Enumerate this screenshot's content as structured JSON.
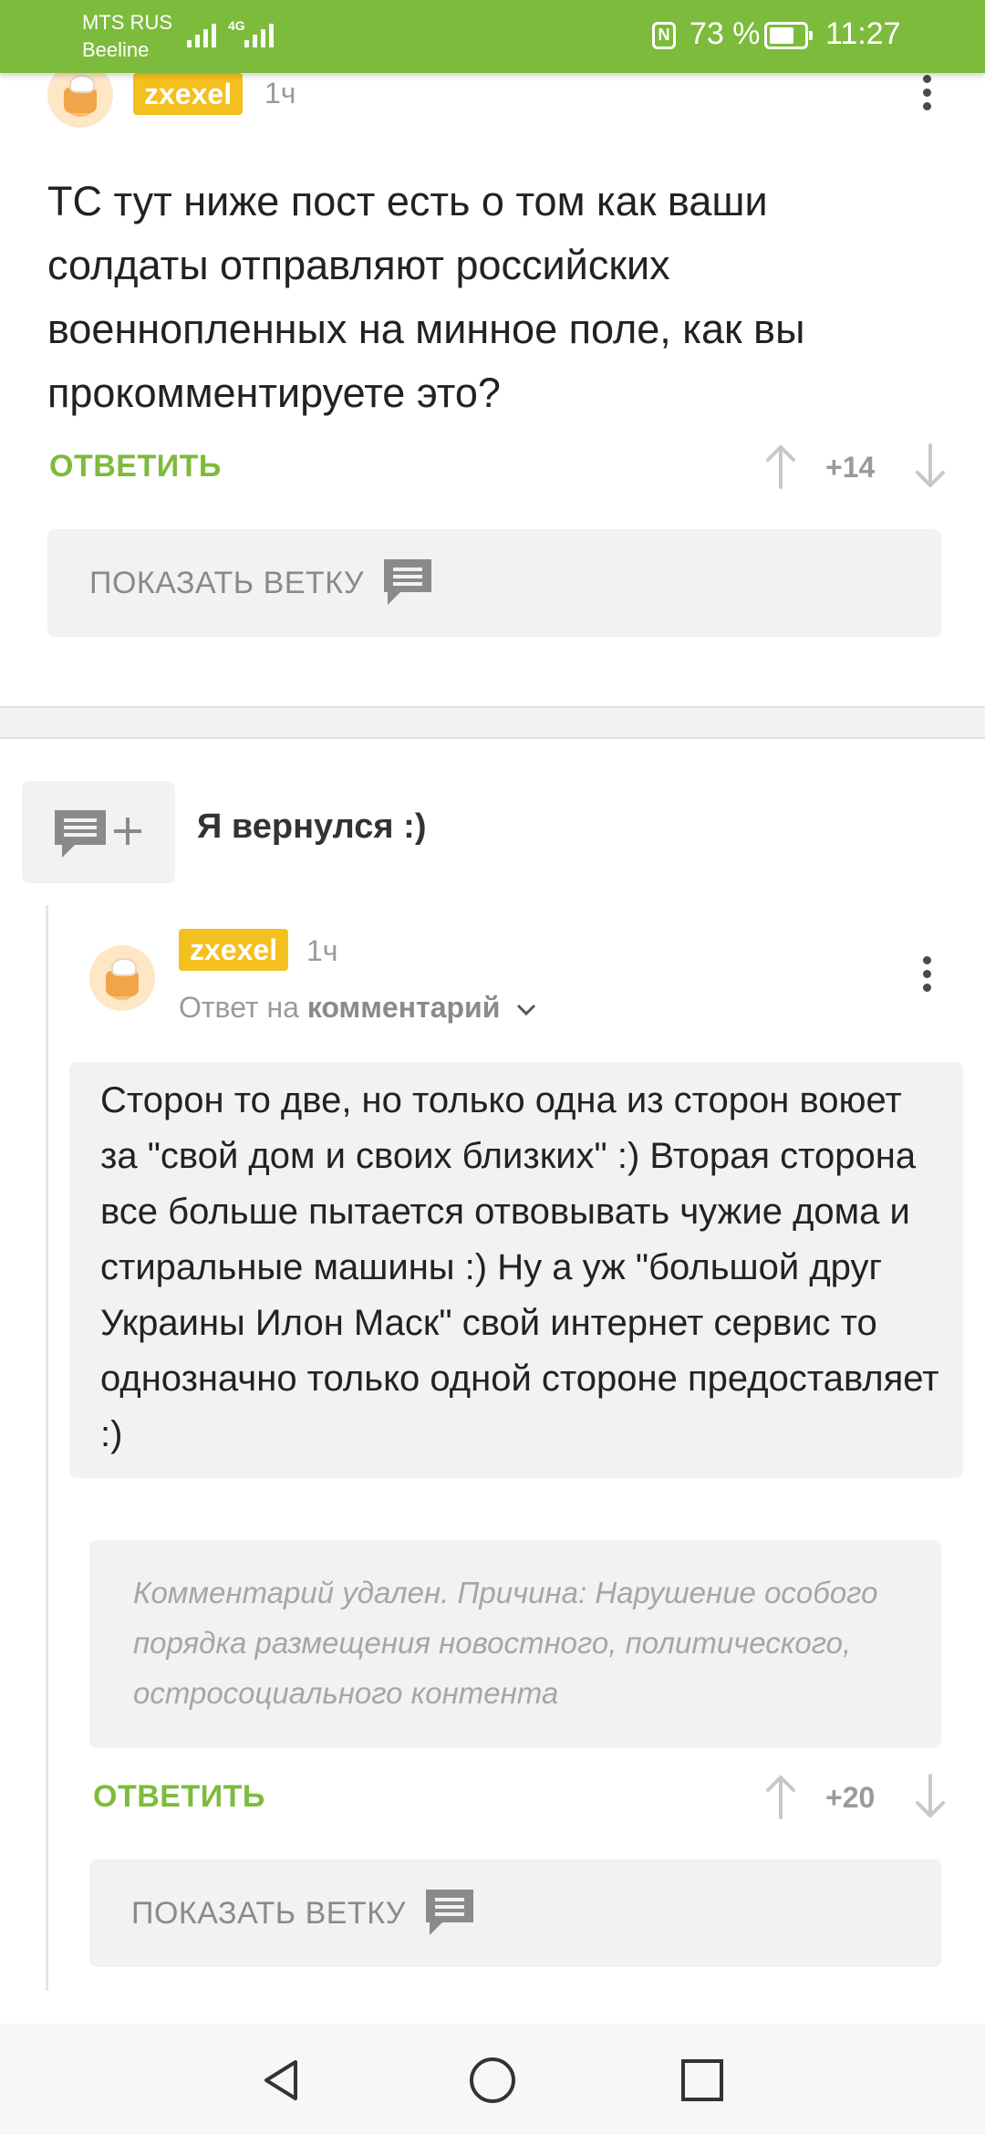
{
  "status_bar": {
    "carrier_1": "MTS RUS",
    "carrier_2": "Beeline",
    "network": "4G",
    "nfc_label": "N",
    "battery_text": "73 %",
    "battery_level": 0.73,
    "time": "11:27"
  },
  "comment1": {
    "username": "zxexel",
    "time": "1ч",
    "text": "ТС тут ниже пост есть о том как ваши солдаты отправляют российских военнопленных на минное поле, как вы прокомментируете это?",
    "reply_label": "ОТВЕТИТЬ",
    "votes": "+14",
    "show_branch_label": "ПОКАЗАТЬ ВЕТКУ"
  },
  "thread": {
    "title": "Я вернулся :)"
  },
  "comment2": {
    "username": "zxexel",
    "time": "1ч",
    "reply_prefix": "Ответ на",
    "reply_target": "комментарий",
    "text": "Сторон то две, но только одна из сторон воюет за \"свой дом и своих близких\" :) Вторая сторона все больше пытается отвовывать чужие дома и стиральные машины :) Ну а уж \"большой друг Украины Илон Маск\" свой интернет сервис то однозначно только одной стороне предоставляет :)",
    "deleted_text": "Комментарий удален. Причина: Нарушение особого порядка размещения новостного, политического, остросоциального контента",
    "reply_label": "ОТВЕТИТЬ",
    "votes": "+20",
    "show_branch_label": "ПОКАЗАТЬ ВЕТКУ"
  },
  "colors": {
    "accent_green": "#7dbb3c",
    "username_badge": "#f4c020",
    "muted_gray": "#9a9a9a"
  },
  "icons": [
    "signal-icon",
    "nfc-icon",
    "battery-icon",
    "more-options-icon",
    "vote-up-icon",
    "vote-down-icon",
    "comments-icon",
    "add-comment-icon",
    "chevron-down-icon",
    "back-icon",
    "home-icon",
    "recents-icon"
  ]
}
